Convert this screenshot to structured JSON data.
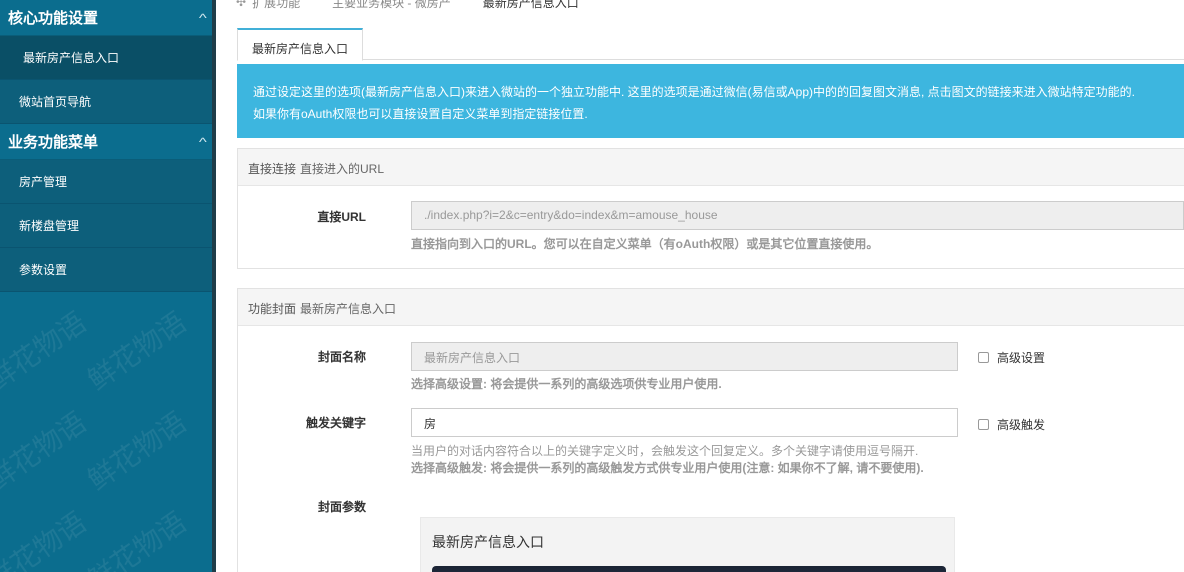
{
  "sidebar": {
    "groups": [
      {
        "title": "核心功能设置",
        "items": [
          {
            "label": "最新房产信息入口",
            "active": true
          },
          {
            "label": "微站首页导航",
            "active": false
          }
        ]
      },
      {
        "title": "业务功能菜单",
        "items": [
          {
            "label": "房产管理",
            "active": false
          },
          {
            "label": "新楼盘管理",
            "active": false
          },
          {
            "label": "参数设置",
            "active": false
          }
        ]
      }
    ]
  },
  "breadcrumbs": [
    "扩展功能",
    "主要业务模块 - 微房产",
    "最新房产信息入口"
  ],
  "tab": "最新房产信息入口",
  "alert": {
    "line1": "通过设定这里的选项(最新房产信息入口)来进入微站的一个独立功能中. 这里的选项是通过微信(易信或App)中的的回复图文消息, 点击图文的链接来进入微站特定功能的.",
    "line2": "如果你有oAuth权限也可以直接设置自定义菜单到指定链接位置."
  },
  "direct": {
    "head": "直接连接",
    "head_sub": "直接进入的URL",
    "label": "直接URL",
    "value": "./index.php?i=2&c=entry&do=index&m=amouse_house",
    "help": "直接指向到入口的URL。您可以在自定义菜单（有oAuth权限）或是其它位置直接使用。"
  },
  "cover": {
    "head": "功能封面",
    "head_sub": "最新房产信息入口",
    "name_label": "封面名称",
    "name_placeholder": "最新房产信息入口",
    "advanced_label": "高级设置",
    "name_help": "选择高级设置: 将会提供一系列的高级选项供专业用户使用.",
    "keyword_label": "触发关键字",
    "keyword_value": "房",
    "advanced_trigger_label": "高级触发",
    "keyword_help1": "当用户的对话内容符合以上的关键字定义时，会触发这个回复定义。多个关键字请使用逗号隔开.",
    "keyword_help2": "选择高级触发: 将会提供一系列的高级触发方式供专业用户使用(注意: 如果你不了解, 请不要使用).",
    "params_label": "封面参数",
    "preview_title": "最新房产信息入口"
  },
  "colors": {
    "sidebar": "#0b6d8e",
    "alert": "#3db6df",
    "tab_accent": "#41b0d8"
  },
  "watermark": "鲜花物语"
}
